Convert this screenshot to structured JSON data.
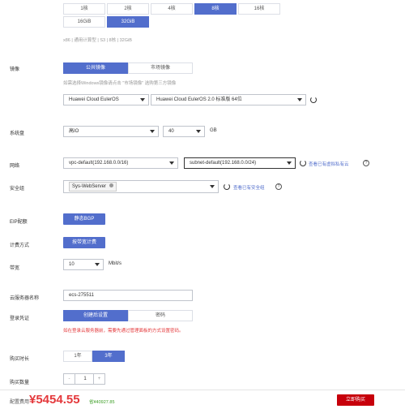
{
  "memory": {
    "row1": [
      "1核",
      "2核",
      "4核",
      "8核",
      "16核"
    ],
    "row2": [
      "16GiB",
      "32GiB"
    ],
    "summary": "x86 | 通用计算型 | S3 | 8核 | 32GiB"
  },
  "image": {
    "label": "镜像",
    "tabs": [
      "公共镜像",
      "市场镜像"
    ],
    "hint": "如需选择Windows镜像请点击 \"市场镜像\" 选购第三方镜像",
    "os_select": "Huawei Cloud EulerOS",
    "version_select": "Huawei Cloud EulerOS 2.0 标准版 64位"
  },
  "disk": {
    "label": "系统盘",
    "type_select": "高IO",
    "size_select": "40",
    "unit": "GB"
  },
  "network": {
    "label": "网络",
    "vpc_select": "vpc-default(192.168.0.0/16)",
    "subnet_select": "subnet-default(192.168.0.0/24)",
    "link": "查看已有虚拟私有云"
  },
  "security": {
    "label": "安全组",
    "tag": "Sys-WebServer",
    "link": "查看已有安全组"
  },
  "eip": {
    "label": "EIP配额",
    "button": "静态BGP"
  },
  "billing": {
    "label": "计费方式",
    "button": "按带宽计费"
  },
  "bandwidth": {
    "label": "带宽",
    "value": "10",
    "unit": "Mbit/s"
  },
  "server_name": {
    "label": "云服务器名称",
    "value": "ecs-275511"
  },
  "login": {
    "label": "登录凭证",
    "tabs": [
      "创建后设置",
      "密码"
    ],
    "warning": "如在登录云服务器前，需要先通过管理面板的方式设置密码。"
  },
  "duration": {
    "label": "购买时长",
    "options": [
      "1年",
      "3年"
    ]
  },
  "quantity": {
    "label": "购买数量",
    "value": "1",
    "minus": "-",
    "plus": "+"
  },
  "footer": {
    "price_label": "配置费用",
    "price": "¥5454.55",
    "savings": "省¥40927.85",
    "buy_button": "立即购买"
  },
  "colors": {
    "accent": "#526ecc",
    "price": "#e4393c",
    "buy": "#c7000b",
    "warning": "#e4393c"
  }
}
